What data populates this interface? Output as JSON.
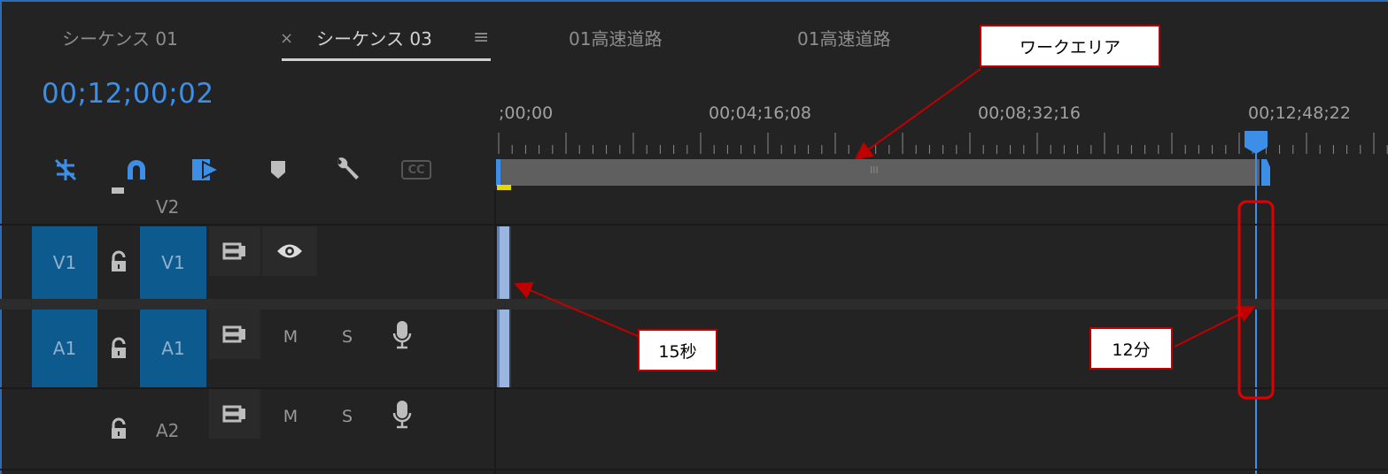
{
  "tabs": [
    {
      "label": "シーケンス 01"
    },
    {
      "label": "シーケンス 03"
    },
    {
      "label": "01高速道路"
    },
    {
      "label": "01高速道路"
    }
  ],
  "tab_close_glyph": "×",
  "tab_menu_glyph": "≡",
  "timecode": "00;12;00;02",
  "ruler": {
    "labels": [
      ";00;00",
      "00;04;16;08",
      "00;08;32;16",
      "00;12;48;22"
    ]
  },
  "workarea_grip": "III",
  "toolbar": {
    "icons": [
      "snap-in-timeline-icon",
      "linked-selection-icon",
      "insert-overwrite-icon",
      "add-marker-icon",
      "timeline-settings-icon",
      "captions-icon"
    ],
    "captions_label": "CC"
  },
  "tracks": {
    "v2": {
      "label": "V2"
    },
    "v1": {
      "source": "V1",
      "label": "V1"
    },
    "a1": {
      "source": "A1",
      "label": "A1",
      "mute": "M",
      "solo": "S"
    },
    "a2": {
      "label": "A2",
      "mute": "M",
      "solo": "S"
    }
  },
  "annotations": {
    "workarea": "ワークエリア",
    "fifteen_sec": "15秒",
    "twelve_min": "12分"
  },
  "colors": {
    "accent": "#3d8ee6",
    "track_target": "#0d5a8e",
    "annotation": "#c00000",
    "in_point": "#e6d800"
  }
}
